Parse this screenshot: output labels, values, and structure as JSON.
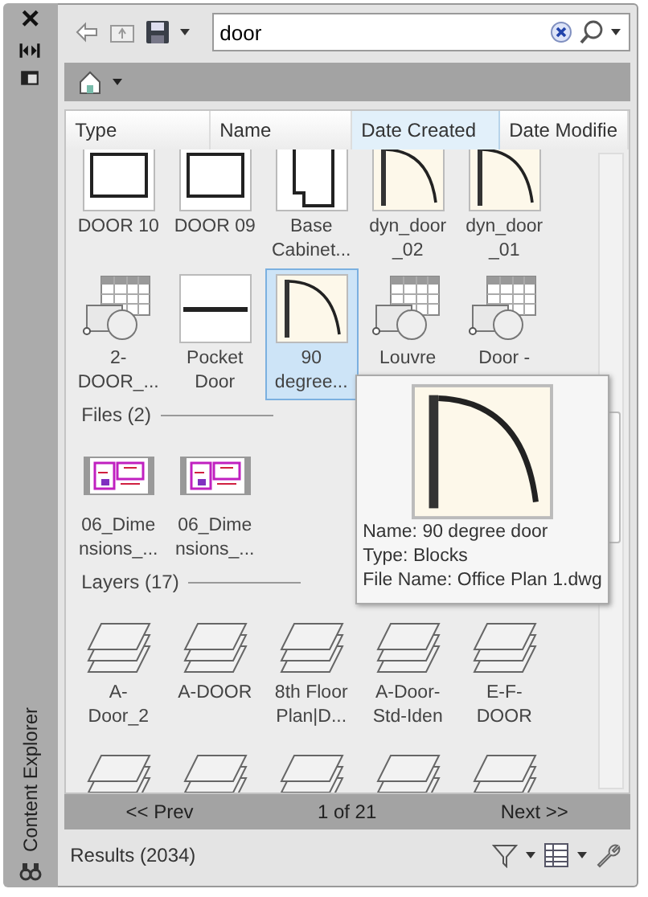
{
  "side_strip": {
    "close": "×",
    "title": "Content Explorer"
  },
  "toolbar": {
    "search": {
      "value": "door"
    }
  },
  "columns": [
    {
      "label": "Type",
      "selected": false
    },
    {
      "label": "Name",
      "selected": false
    },
    {
      "label": "Date Created",
      "selected": true
    },
    {
      "label": "Date Modifie",
      "selected": false
    }
  ],
  "sections": [
    {
      "items": [
        {
          "kind": "door-rect",
          "label": "DOOR 10",
          "selected": false
        },
        {
          "kind": "door-rect",
          "label": "DOOR 09",
          "selected": false
        },
        {
          "kind": "cabinet",
          "label": "Base\nCabinet...",
          "selected": false
        },
        {
          "kind": "door-swing",
          "label": "dyn_door\n_02",
          "selected": false
        },
        {
          "kind": "door-swing",
          "label": "dyn_door\n_01",
          "selected": false
        },
        {
          "kind": "table",
          "label": "2-\nDOOR_...",
          "selected": false
        },
        {
          "kind": "pocket",
          "label": "Pocket\nDoor",
          "selected": false
        },
        {
          "kind": "door-swing",
          "label": "90\ndegree...",
          "selected": true
        },
        {
          "kind": "table",
          "label": "Louvre",
          "selected": false
        },
        {
          "kind": "table",
          "label": "Door -",
          "selected": false
        }
      ]
    },
    {
      "title": "Files (2)",
      "items": [
        {
          "kind": "file",
          "label": "06_Dime\nnsions_...",
          "selected": false
        },
        {
          "kind": "file",
          "label": "06_Dime\nnsions_...",
          "selected": false
        }
      ]
    },
    {
      "title": "Layers (17)",
      "items": [
        {
          "kind": "layer",
          "label": "A-\nDoor_2",
          "selected": false
        },
        {
          "kind": "layer",
          "label": "A-DOOR",
          "selected": false
        },
        {
          "kind": "layer",
          "label": "8th Floor\nPlan|D...",
          "selected": false
        },
        {
          "kind": "layer",
          "label": "A-Door-\nStd-Iden",
          "selected": false
        },
        {
          "kind": "layer",
          "label": "E-F-\nDOOR",
          "selected": false
        },
        {
          "kind": "layer",
          "selected": false
        },
        {
          "kind": "layer",
          "selected": false
        },
        {
          "kind": "layer",
          "selected": false
        },
        {
          "kind": "layer",
          "selected": false
        },
        {
          "kind": "layer",
          "selected": false
        }
      ]
    }
  ],
  "tooltip": {
    "lines": [
      "Name: 90 degree door",
      "Type: Blocks",
      "File Name: Office Plan 1.dwg"
    ]
  },
  "pager": {
    "prev": "<< Prev",
    "page": "1 of 21",
    "next": "Next >>"
  },
  "status_bar": {
    "results": "Results (2034)"
  }
}
